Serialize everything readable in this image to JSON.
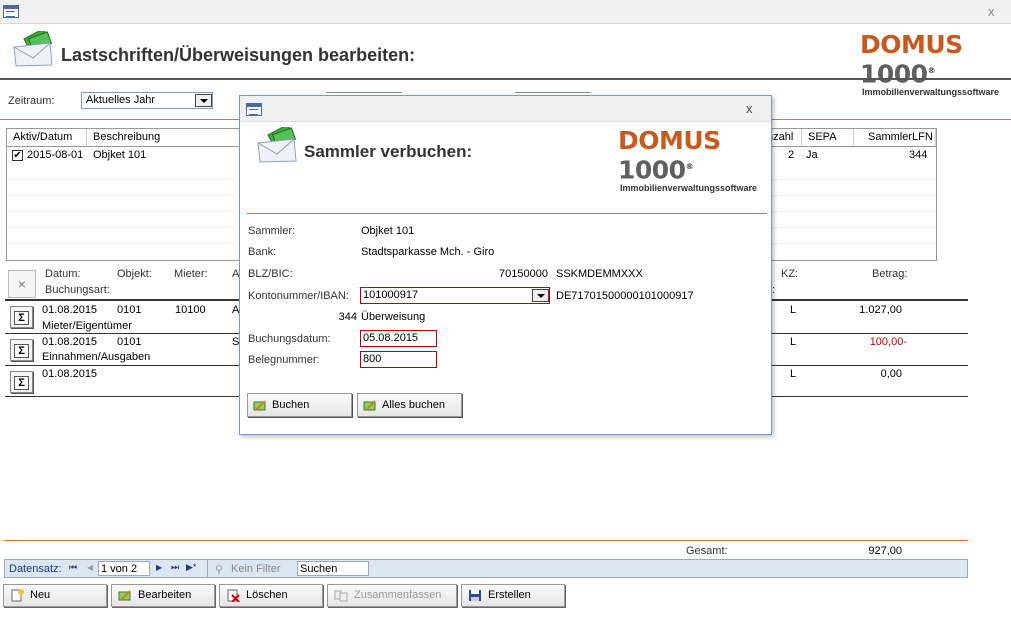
{
  "window": {
    "close_glyph": "x"
  },
  "header": {
    "title": "Lastschriften/Überweisungen bearbeiten:",
    "logo_main_a": "DOMUS ",
    "logo_main_b": "1000",
    "logo_reg": "®",
    "logo_sub": "Immobilienverwaltungssoftware"
  },
  "filter": {
    "zeitraum_label": "Zeitraum:",
    "zeitraum_value": "Aktuelles Jahr"
  },
  "grid": {
    "columns": [
      "Aktiv/Datum",
      "Beschreibung",
      "nzahl",
      "SEPA",
      "SammlerLFN"
    ],
    "rows": [
      {
        "checked": true,
        "check_glyph": "✔",
        "datum": "2015-08-01",
        "beschreibung": "Objket 101",
        "anzahl": "2",
        "sepa": "Ja",
        "lfn": "344"
      }
    ]
  },
  "detail": {
    "clear_glyph": "×",
    "headers": {
      "datum": "Datum:",
      "objekt": "Objekt:",
      "mieter": "Mieter:",
      "a": "A",
      "buchungsart": "Buchungsart:",
      "kz": "KZ:",
      "betrag": "Betrag:",
      "colon": ":"
    },
    "rows": [
      {
        "datum": "01.08.2015",
        "objekt": "0101",
        "mieter": "10100",
        "a": "A",
        "art": "Mieter/Eigentümer",
        "kz": "L",
        "betrag": "1.027,00",
        "negative": false
      },
      {
        "datum": "01.08.2015",
        "objekt": "0101",
        "mieter": "",
        "a": "S",
        "art": "Einnahmen/Ausgaben",
        "kz": "L",
        "betrag": "100,00-",
        "negative": true
      },
      {
        "datum": "01.08.2015",
        "objekt": "",
        "mieter": "",
        "a": "",
        "art": "",
        "kz": "L",
        "betrag": "0,00",
        "negative": false
      }
    ],
    "sigma": "Σ",
    "gesamt_label": "Gesamt:",
    "gesamt_value": "927,00"
  },
  "nav": {
    "label": "Datensatz:",
    "first": "⏮",
    "prev": "◀",
    "position": "1 von 2",
    "next": "▶",
    "last": "⏭",
    "new": "▶*",
    "filter": "Kein Filter",
    "search": "Suchen"
  },
  "buttons": {
    "neu": "Neu",
    "bearbeiten": "Bearbeiten",
    "loeschen": "Löschen",
    "zusammenfassen": "Zusammenfassen",
    "erstellen": "Erstellen"
  },
  "modal": {
    "close_glyph": "x",
    "title": "Sammler verbuchen:",
    "sammler_label": "Sammler:",
    "sammler_value": "Objket 101",
    "bank_label": "Bank:",
    "bank_value": "Stadtsparkasse Mch. - Giro",
    "blz_label": "BLZ/BIC:",
    "blz_value": "70150000",
    "bic_value": "SSKMDEMMXXX",
    "konto_label": "Kontonummer/IBAN:",
    "konto_value": "101000917",
    "iban_value": "DE71701500000101000917",
    "lfn": "344",
    "art": "Überweisung",
    "buchungsdatum_label": "Buchungsdatum:",
    "buchungsdatum_value": "05.08.2015",
    "belegnummer_label": "Belegnummer:",
    "belegnummer_value": "800",
    "buchen": "Buchen",
    "alles_buchen": "Alles buchen"
  },
  "colors": {
    "accent": "#e07030",
    "brand": "#c85a1e",
    "negative": "#c00000",
    "nav_bg": "#dce6f2"
  },
  "icons": [
    "form-icon",
    "envelope-money-icon",
    "sigma-icon",
    "new-record-icon",
    "edit-icon",
    "delete-icon",
    "merge-icon",
    "save-icon",
    "filter-icon",
    "checkmark-icon"
  ]
}
